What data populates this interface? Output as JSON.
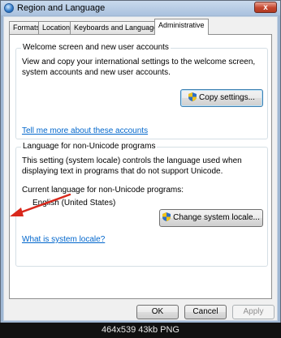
{
  "window": {
    "title": "Region and Language",
    "close_glyph": "x"
  },
  "tabs": [
    {
      "label": "Formats"
    },
    {
      "label": "Location"
    },
    {
      "label": "Keyboards and Languages"
    },
    {
      "label": "Administrative",
      "active": true
    }
  ],
  "welcome": {
    "group_label": "Welcome screen and new user accounts",
    "description": "View and copy your international settings to the welcome screen, system accounts and new user accounts.",
    "copy_button": "Copy settings...",
    "link": "Tell me more about these accounts"
  },
  "nonunicode": {
    "group_label": "Language for non-Unicode programs",
    "description": "This setting (system locale) controls the language used when displaying text in programs that do not support Unicode.",
    "current_label": "Current language for non-Unicode programs:",
    "current_value": "English (United States)",
    "change_button": "Change system locale...",
    "link": "What is system locale?"
  },
  "dialog_buttons": {
    "ok": "OK",
    "cancel": "Cancel",
    "apply": "Apply"
  },
  "caption": "464x539 43kb PNG",
  "colors": {
    "accent_link": "#0066cc",
    "arrow": "#d9281c",
    "shield_yellow": "#f2c318",
    "shield_blue": "#2f6fc4"
  },
  "icons": [
    "globe-icon",
    "close-icon",
    "uac-shield-icon",
    "red-arrow-annotation"
  ]
}
